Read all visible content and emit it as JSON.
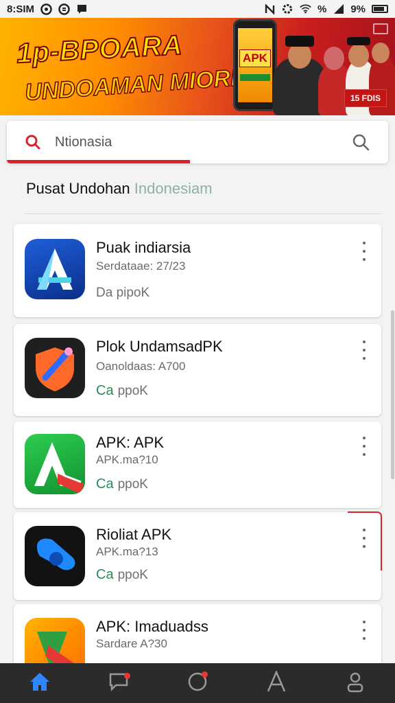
{
  "status_bar": {
    "time": "8:SIM",
    "battery": "9%",
    "signal": "%"
  },
  "banner": {
    "headline_top": "1p-BPOARA",
    "headline_bottom": "UNDOAMAN MIORIA!",
    "phone_label": "APK",
    "badge": "15 FDIS",
    "colors": {
      "start": "#ffb300",
      "end": "#a3121b"
    }
  },
  "search": {
    "value": "Ntionasia",
    "icon_left": "search-icon",
    "icon_right": "search-icon",
    "progress_percent": 48,
    "accent": "#d8232a"
  },
  "section": {
    "title_main": "Pusat Undohan",
    "title_accent": "Indonesiam"
  },
  "apps": [
    {
      "name": "Puak indiarsia",
      "meta": "Serdataae: 27/23",
      "download": "Da  pipoK",
      "dl_mark": "",
      "icon": "blue-a-icon"
    },
    {
      "name": "Plok UndamsadPK",
      "meta": "Oanoldaas: A700",
      "download": "ppoK",
      "dl_mark": "Ca",
      "icon": "orange-shield-icon"
    },
    {
      "name": "APK: APK",
      "meta": "APK.ma?10",
      "download": "ppoK",
      "dl_mark": "Ca",
      "icon": "green-a-icon"
    },
    {
      "name": "Rioliat APK",
      "meta": "APK.ma?13",
      "download": "ppoK",
      "dl_mark": "Ca",
      "icon": "blue-chat-icon"
    },
    {
      "name": "APK: Imaduadss",
      "meta": "Sardare A?30",
      "download": "",
      "dl_mark": "",
      "icon": "flag-a-icon"
    }
  ],
  "bottom_nav": {
    "items": [
      "home-icon",
      "chat-icon",
      "circle-icon",
      "apps-icon",
      "profile-icon"
    ],
    "active": "home-icon",
    "active_color": "#2f86ff"
  }
}
